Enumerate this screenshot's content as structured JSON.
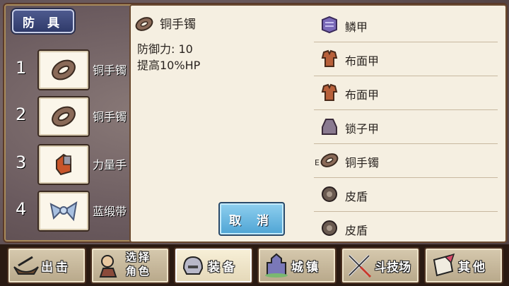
{
  "category": "防 具",
  "slots": [
    {
      "num": "1",
      "label": "铜手镯",
      "icon": "bracelet-icon"
    },
    {
      "num": "2",
      "label": "铜手镯",
      "icon": "bracelet-icon"
    },
    {
      "num": "3",
      "label": "力量手",
      "icon": "gauntlet-icon"
    },
    {
      "num": "4",
      "label": "蓝缎带",
      "icon": "ribbon-icon"
    }
  ],
  "detail": {
    "name": "铜手镯",
    "stat1": "防御力: 10",
    "stat2": "提高10%HP",
    "icon": "bracelet-icon"
  },
  "cancel_label": "取 消",
  "list": [
    {
      "label": "鳞甲",
      "icon": "scale-armor-icon"
    },
    {
      "label": "布面甲",
      "icon": "cloth-armor-icon"
    },
    {
      "label": "布面甲",
      "icon": "cloth-armor-icon"
    },
    {
      "label": "锁子甲",
      "icon": "chainmail-icon"
    },
    {
      "label": "铜手镯",
      "icon": "bracelet-icon",
      "marker": "E"
    },
    {
      "label": "皮盾",
      "icon": "shield-icon"
    },
    {
      "label": "皮盾",
      "icon": "shield-icon"
    }
  ],
  "menu": [
    {
      "label": "出击",
      "icon": "ship-icon"
    },
    {
      "label_line1": "选择",
      "label_line2": "角色",
      "icon": "character-icon"
    },
    {
      "label": "装备",
      "icon": "helmet-icon",
      "active": true
    },
    {
      "label": "城镇",
      "icon": "castle-icon"
    },
    {
      "label": "斗技场",
      "icon": "swords-icon"
    },
    {
      "label": "其他",
      "icon": "scroll-icon"
    }
  ]
}
